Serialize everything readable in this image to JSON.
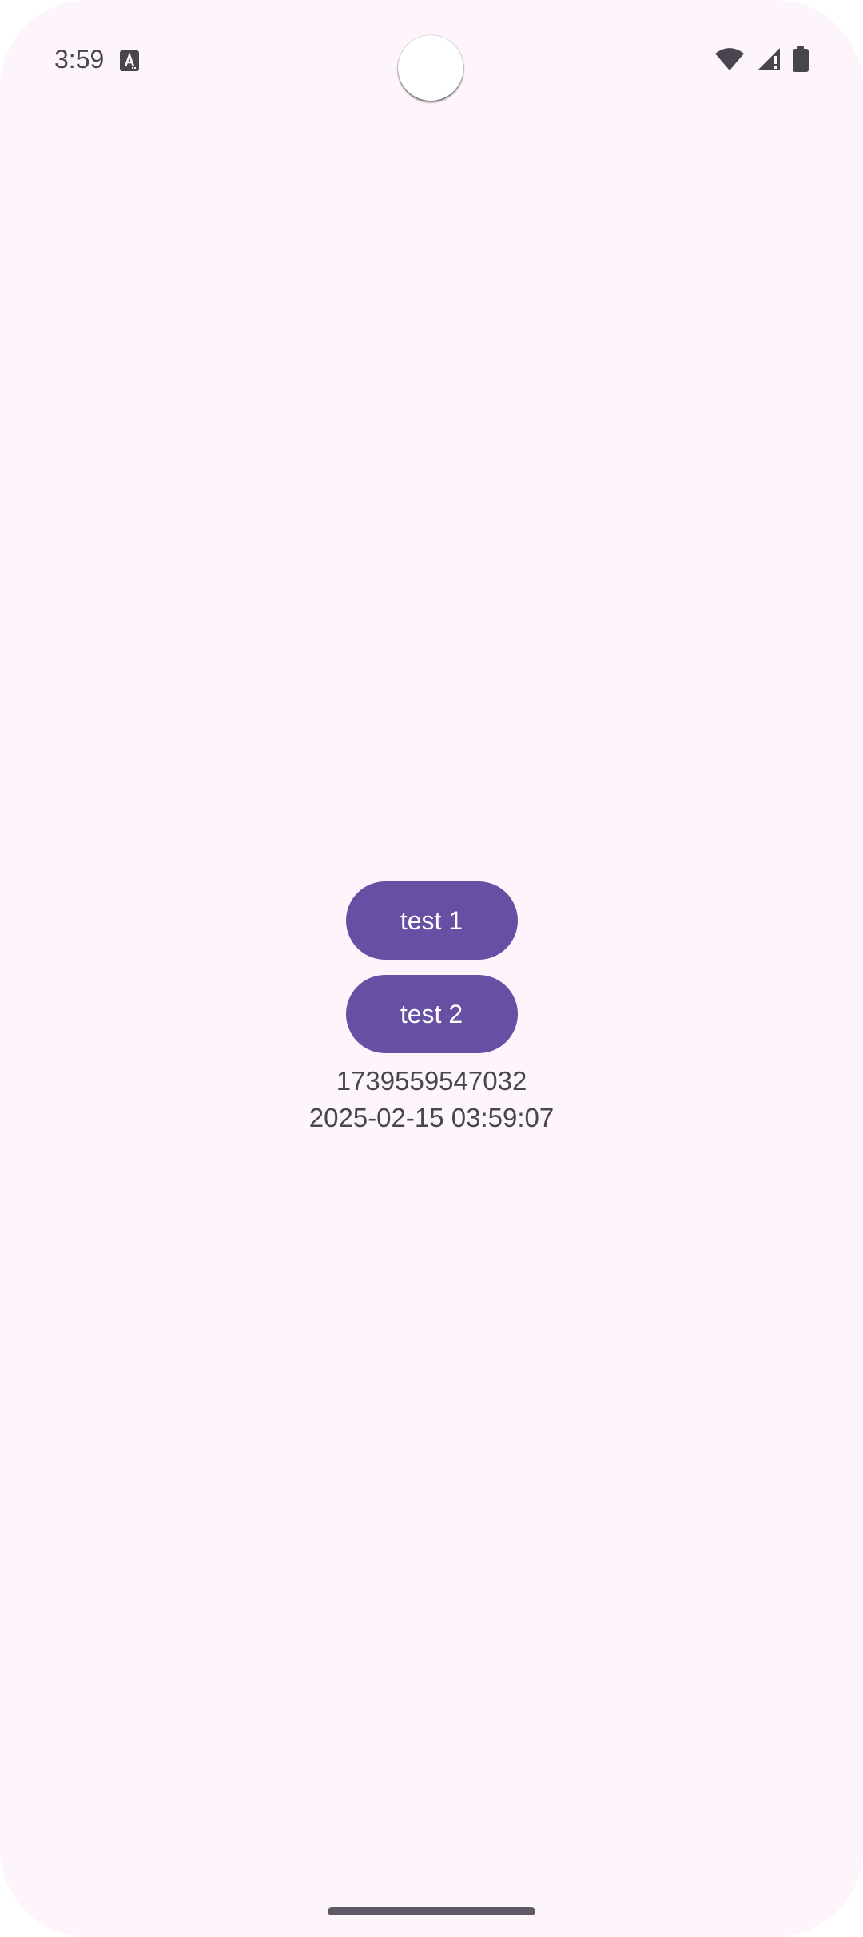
{
  "status_bar": {
    "time": "3:59",
    "notification_icon": "text-a-icon",
    "wifi_icon": "wifi-icon",
    "signal_icon": "signal-icon",
    "battery_icon": "battery-icon"
  },
  "main": {
    "button1_label": "test 1",
    "button2_label": "test 2",
    "timestamp_ms": "1739559547032",
    "datetime": "2025-02-15 03:59:07"
  },
  "colors": {
    "background": "#fdf4fc",
    "button": "#6750a4",
    "button_text": "#ffffff",
    "text": "#49454f"
  }
}
